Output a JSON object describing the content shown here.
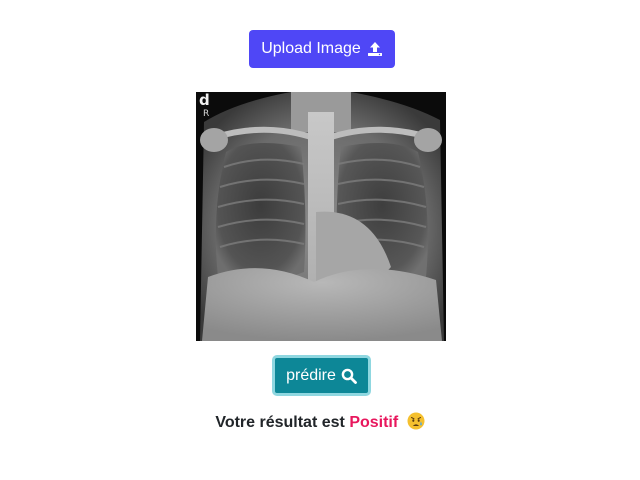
{
  "upload": {
    "label": "Upload Image",
    "icon": "upload-icon",
    "color": "#4f47f6"
  },
  "xray": {
    "marker": "d",
    "side_label": "R"
  },
  "predict": {
    "label": "prédire",
    "icon": "search-icon",
    "color": "#0d8797"
  },
  "result": {
    "prefix": "Votre résultat est",
    "value": "Positif",
    "value_color": "#e8175d",
    "emoji": "worried-face-icon"
  }
}
